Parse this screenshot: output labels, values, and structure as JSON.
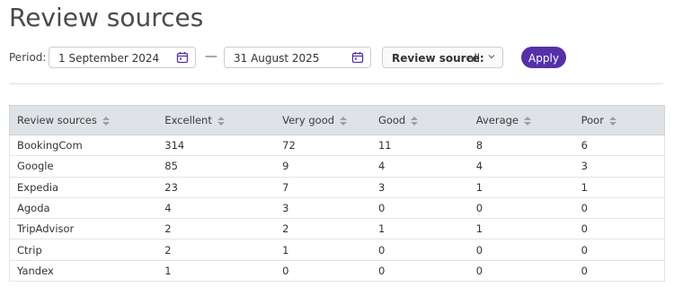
{
  "page": {
    "title": "Review sources"
  },
  "filters": {
    "period_label": "Period:",
    "start_date": "1 September 2024",
    "separator": "—",
    "end_date": "31 August 2025",
    "source_label": "Review source:",
    "source_value": "all",
    "apply_label": "Apply"
  },
  "colors": {
    "accent": "#5530a8",
    "header_bg": "#dfe2e7"
  },
  "icons": {
    "date": "calendar-icon",
    "dropdown": "chevron-down-icon",
    "sort": "sort-icon"
  },
  "table": {
    "columns": [
      "Review sources",
      "Excellent",
      "Very good",
      "Good",
      "Average",
      "Poor"
    ],
    "rows": [
      [
        "BookingCom",
        "314",
        "72",
        "11",
        "8",
        "6"
      ],
      [
        "Google",
        "85",
        "9",
        "4",
        "4",
        "3"
      ],
      [
        "Expedia",
        "23",
        "7",
        "3",
        "1",
        "1"
      ],
      [
        "Agoda",
        "4",
        "3",
        "0",
        "0",
        "0"
      ],
      [
        "TripAdvisor",
        "2",
        "2",
        "1",
        "1",
        "0"
      ],
      [
        "Ctrip",
        "2",
        "1",
        "0",
        "0",
        "0"
      ],
      [
        "Yandex",
        "1",
        "0",
        "0",
        "0",
        "0"
      ]
    ]
  }
}
